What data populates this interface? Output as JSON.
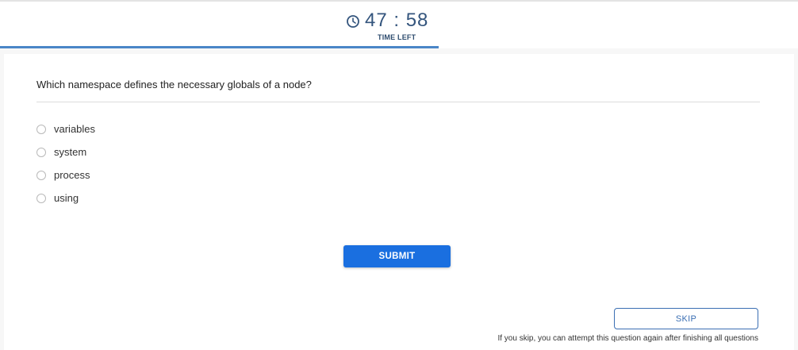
{
  "timer": {
    "value": "47 : 58",
    "label": "TIME LEFT",
    "icon": "clock-icon",
    "remaining_fraction": 0.55
  },
  "question": {
    "text": "Which namespace defines the necessary globals of a node?",
    "options": [
      {
        "label": "variables"
      },
      {
        "label": "system"
      },
      {
        "label": "process"
      },
      {
        "label": "using"
      }
    ]
  },
  "actions": {
    "submit_label": "SUBMIT",
    "skip_label": "SKIP",
    "skip_note": "If you skip, you can attempt this question again after finishing all questions"
  },
  "colors": {
    "accent": "#1a6fe0",
    "timer": "#34557d",
    "progress": "#4a86c7"
  }
}
